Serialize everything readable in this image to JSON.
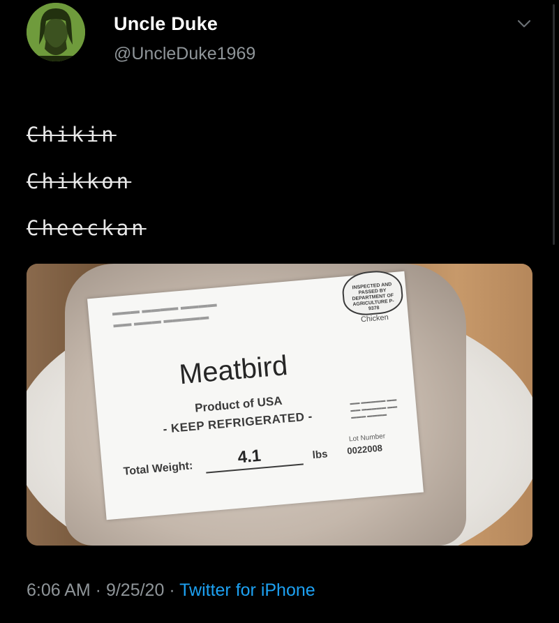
{
  "tweet": {
    "user": {
      "display_name": "Uncle Duke",
      "handle": "@UncleDuke1969",
      "avatar_icon": "user-avatar-photo"
    },
    "menu_icon": "chevron-down-icon",
    "lines": [
      "Chikin",
      "Chikkon",
      "Cheeckan"
    ],
    "media": {
      "label": {
        "brand": "Meatbird",
        "usda_text": "INSPECTED AND PASSED BY DEPARTMENT OF AGRICULTURE P-9378",
        "category": "Chicken",
        "product_of": "Product of USA",
        "instructions": "- KEEP REFRIGERATED -",
        "total_weight_label": "Total Weight:",
        "weight": "4.1",
        "unit": "lbs",
        "lot_number_label": "Lot Number",
        "lot_number": "0022008"
      }
    },
    "meta": {
      "time": "6:06 AM",
      "date": "9/25/20",
      "separator": " · ",
      "source": "Twitter for iPhone"
    }
  },
  "colors": {
    "background": "#000000",
    "primary_text": "#ffffff",
    "secondary_text": "#8f9599",
    "link": "#1da1f2"
  }
}
